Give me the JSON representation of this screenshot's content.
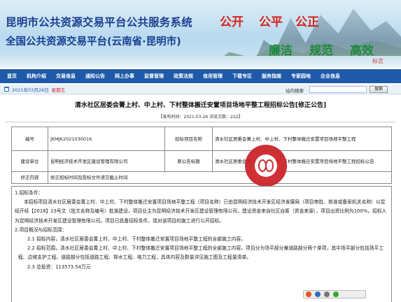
{
  "header": {
    "title_line1": "昆明市公共资源交易平台公共服务系统",
    "title_line2": "全国公共资源交易平台(云南省·昆明市)",
    "slogan_red": [
      "公开",
      "公平",
      "公正"
    ],
    "slogan_green": [
      "廉洁",
      "规范",
      "高效"
    ],
    "seal_text": "标志"
  },
  "nav": {
    "items": [
      "首页",
      "机构介绍",
      "交易信息",
      "通知公告",
      "网上办事",
      "监督管理",
      "政策法规",
      "信用管理",
      "下载专区",
      "服务指南",
      "专家园地",
      "企业信息"
    ]
  },
  "datebar": {
    "date": "2021年03月26日",
    "weekday": "星期五",
    "search_label": "站内搜索",
    "search_placeholder": "",
    "search_button": "搜索"
  },
  "article": {
    "title": "清水社区居委会箐上村、中上村、下村整体搬迁安置项目场地平整工程招标公告[修正公告]",
    "meta": "【发布时间：2021-03-26   浏览次数：222】"
  },
  "info_table": {
    "code_label": "编号",
    "code_value": "JKMJK2021030016",
    "project_label": "招标项目名称",
    "project_value": "清水社区居委会箐上村、中上村、下村整体搬迁安置项目场地平整工程",
    "owner_label": "建设单位",
    "owner_value": "昆明经济技术开发区建设管理有限公司",
    "orig_label": "原公告标题",
    "orig_value": "清水社区居委会箐上村、中上村、下村整体搬迁安置项目场地平整工程招标公告",
    "revise_label": "修正内容",
    "revise_value": "修正招标时间及投标文件递交截止时间"
  },
  "content": {
    "s1": "1.招标条件：",
    "p1": "本招标项目清水社区居委会箐上村、中上村、下村整体搬迁安置项目场地平整工程（项目名称）已由昆明经济技术开发区经济发展局（项目审批、核准或备案机关名称）以昆经开经【2018】23号文（批文名称及编号）批准建设，项目业主为昆明经济技术开发区建设管理有限公司，建设资金来自社区自筹（资金来源），项目出资比例为100%，招标人为昆明经济技术开发区建设管理有限公司。项目已具备招标条件，现对该项目的施工进行公开招标。",
    "s2": "2.项目概况与招标范围：",
    "p21": "2.1 招标内容，清水社区居委会箐上村、中上村、下村整体搬迁安置项目场地平整工程的全部施工内容。",
    "p22": "2.2 招标范围，清水社区居委会箐上村、中上村、下村整体搬迁安置项目场地平整工程的全部施工内容。项目分为场平部分兼道路部分两个单项，其中场平部分包括场平工程、边坡支护工程，道路部分包括道路工程、排水工程、电力工程，具体内容及数量详见施工图及工程量清单。",
    "p23": "2.3 总投资：113573.54万元"
  }
}
